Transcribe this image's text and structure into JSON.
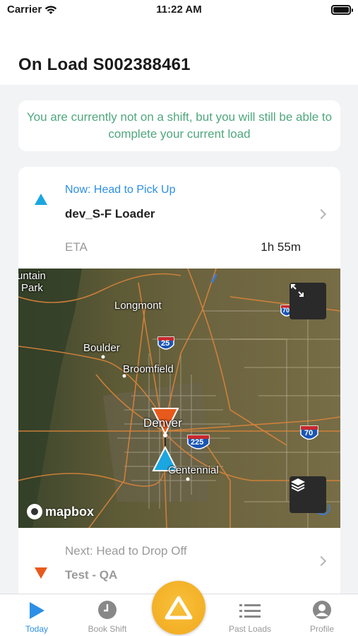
{
  "status_bar": {
    "carrier": "Carrier",
    "time": "11:22 AM"
  },
  "header": {
    "title": "On Load S002388461"
  },
  "notice": {
    "text": "You are currently not on a shift, but you will still be able to complete your current load"
  },
  "current_stop": {
    "label": "Now: Head to Pick Up",
    "name": "dev_S-F Loader",
    "eta_label": "ETA",
    "eta_value": "1h 55m",
    "marker_color": "#1ba6e0"
  },
  "map": {
    "labels": {
      "mountain": "untain",
      "park": "Park",
      "longmont": "Longmont",
      "boulder": "Boulder",
      "broomfield": "Broomfield",
      "denver": "Denver",
      "centennial": "Centennial",
      "i25": "25",
      "i225": "225",
      "i70": "70",
      "i70_top": "70"
    },
    "attribution": "mapbox",
    "buttons": [
      "expand-icon",
      "layers-icon"
    ]
  },
  "next_stop": {
    "label": "Next: Head to Drop Off",
    "name": "Test - QA",
    "marker_color": "#e85a1c"
  },
  "tabs": [
    {
      "label": "Today",
      "icon": "play-icon",
      "active": true
    },
    {
      "label": "Book Shift",
      "icon": "clock-icon",
      "active": false
    },
    {
      "label": "Past Loads",
      "icon": "list-icon",
      "active": false
    },
    {
      "label": "Profile",
      "icon": "person-icon",
      "active": false
    }
  ],
  "colors": {
    "accent": "#2d8fe6",
    "notice": "#4fa77d",
    "pickup": "#1ba6e0",
    "dropoff": "#e85a1c",
    "center_button": "#f2a81e"
  }
}
